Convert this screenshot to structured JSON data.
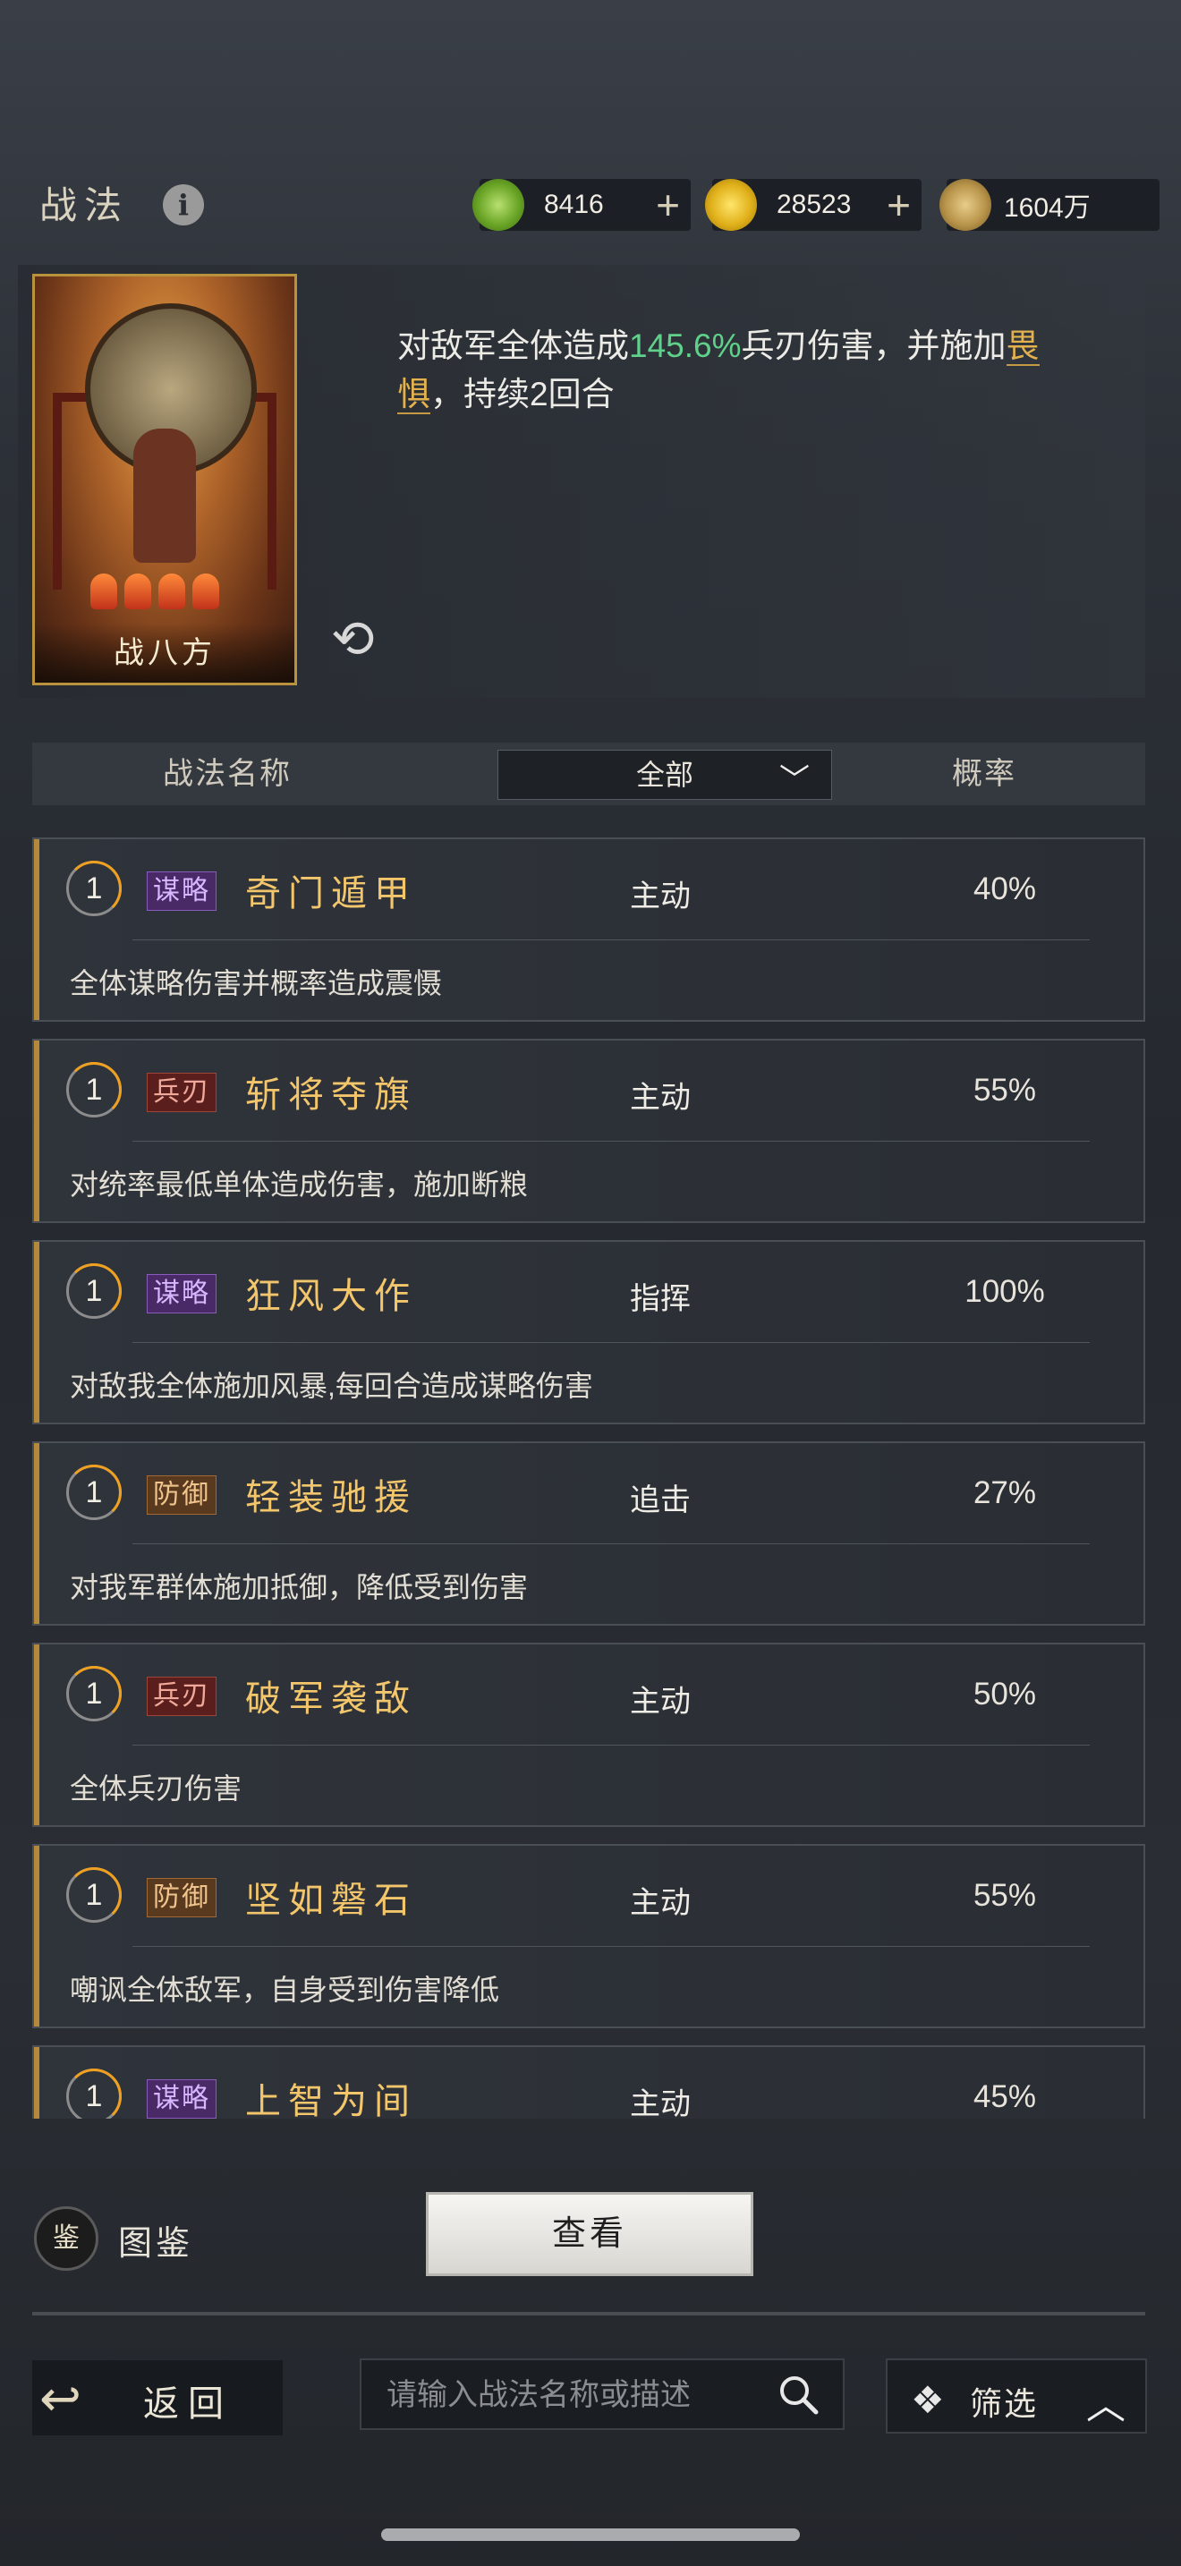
{
  "header": {
    "title": "战法",
    "info_icon": "ⅰ",
    "resources": [
      {
        "name": "jade",
        "value": "8416",
        "plus": "+",
        "color": "#7fbf3a"
      },
      {
        "name": "gold",
        "value": "28523",
        "plus": "+",
        "color": "#e2b318"
      },
      {
        "name": "copper",
        "value": "1604万",
        "color": "#b8944a"
      }
    ]
  },
  "skill_card": {
    "name": "战八方",
    "description_parts": {
      "p1": "对敌军全体造成",
      "pct": "145.6%",
      "p2": "兵刃伤害，并施加",
      "keyword": "畏惧",
      "p3": "，持续2回合"
    },
    "refresh_icon": "⟲"
  },
  "table_header": {
    "name_col": "战法名称",
    "filter_value": "全部",
    "prob_col": "概率"
  },
  "skills": [
    {
      "level": "1",
      "tag": "谋略",
      "name": "奇门遁甲",
      "type": "主动",
      "prob": "40%",
      "desc": "全体谋略伤害并概率造成震慑"
    },
    {
      "level": "1",
      "tag": "兵刃",
      "name": "斩将夺旗",
      "type": "主动",
      "prob": "55%",
      "desc": "对统率最低单体造成伤害，施加断粮"
    },
    {
      "level": "1",
      "tag": "谋略",
      "name": "狂风大作",
      "type": "指挥",
      "prob": "100%",
      "desc": "对敌我全体施加风暴,每回合造成谋略伤害"
    },
    {
      "level": "1",
      "tag": "防御",
      "name": "轻装驰援",
      "type": "追击",
      "prob": "27%",
      "desc": "对我军群体施加抵御，降低受到伤害"
    },
    {
      "level": "1",
      "tag": "兵刃",
      "name": "破军袭敌",
      "type": "主动",
      "prob": "50%",
      "desc": "全体兵刃伤害"
    },
    {
      "level": "1",
      "tag": "防御",
      "name": "坚如磐石",
      "type": "主动",
      "prob": "55%",
      "desc": "嘲讽全体敌军，自身受到伤害降低"
    },
    {
      "level": "1",
      "tag": "谋略",
      "name": "上智为间",
      "type": "主动",
      "prob": "45%",
      "desc": ""
    }
  ],
  "bottom": {
    "book_icon_text": "鉴",
    "book_label": "图鉴",
    "view_button": "查看",
    "back_label": "返回",
    "search_placeholder": "请输入战法名称或描述",
    "filter_label": "筛选"
  }
}
